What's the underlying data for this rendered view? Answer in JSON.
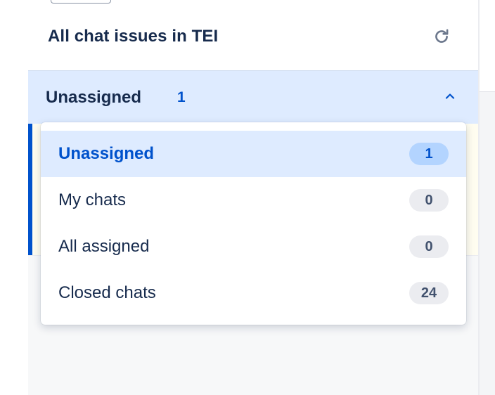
{
  "header": {
    "title": "All chat issues in TEI"
  },
  "selector": {
    "label": "Unassigned",
    "count": "1",
    "expanded": true
  },
  "dropdown": {
    "items": [
      {
        "label": "Unassigned",
        "count": "1",
        "selected": true
      },
      {
        "label": "My chats",
        "count": "0",
        "selected": false
      },
      {
        "label": "All assigned",
        "count": "0",
        "selected": false
      },
      {
        "label": "Closed chats",
        "count": "24",
        "selected": false
      }
    ]
  },
  "icons": {
    "refresh": "refresh-icon",
    "chevron": "chevron-up-icon"
  },
  "colors": {
    "accent": "#0052cc",
    "selected_bg": "#deebff",
    "text": "#172b4d",
    "badge_bg": "#ebecf0"
  }
}
